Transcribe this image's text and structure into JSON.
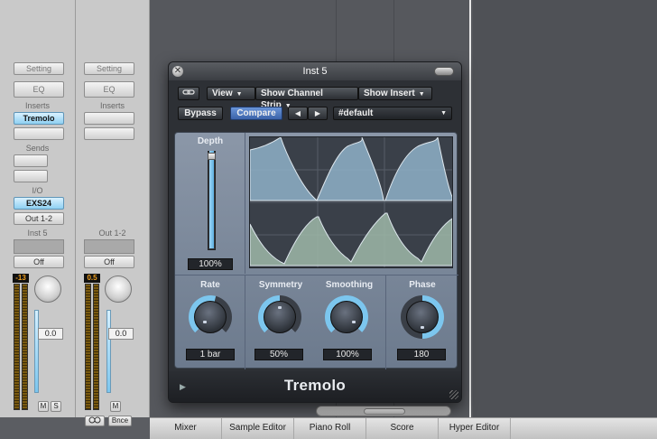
{
  "strips": [
    {
      "setting": "Setting",
      "eq": "EQ",
      "inserts_label": "Inserts",
      "insert1": "Tremolo",
      "sends_label": "Sends",
      "io_label": "I/O",
      "input": "EXS24",
      "output": "Out 1-2",
      "name": "Inst 5",
      "automation": "Off",
      "peak": "-13",
      "fader_value": "0.0",
      "mute": "M",
      "solo": "S"
    },
    {
      "setting": "Setting",
      "eq": "EQ",
      "inserts_label": "Inserts",
      "name": "Out 1-2",
      "automation": "Off",
      "peak": "0.5",
      "fader_value": "0.0",
      "mute": "M",
      "bounce": "Bnce"
    }
  ],
  "plugin": {
    "window_title": "Inst 5",
    "close_glyph": "✕",
    "toolbar": {
      "link_glyph": "🔗",
      "view": "View",
      "show_channel_strip": "Show Channel Strip",
      "show_insert": "Show Insert",
      "bypass": "Bypass",
      "compare": "Compare",
      "prev": "◀",
      "next": "▶",
      "preset": "#default",
      "dropdown_glyph": "▼"
    },
    "depth": {
      "label": "Depth",
      "value": "100%",
      "level": 1.0
    },
    "rate": {
      "label": "Rate",
      "value": "1 bar"
    },
    "symmetry": {
      "label": "Symmetry",
      "value": "50%"
    },
    "smoothing": {
      "label": "Smoothing",
      "value": "100%"
    },
    "phase": {
      "label": "Phase",
      "value": "180"
    },
    "name": "Tremolo",
    "disclosure_glyph": "▶",
    "colors": {
      "accent": "#7cc6ee",
      "wave_upper": "#8fb2c8",
      "wave_lower": "#9fb9a8"
    }
  },
  "tabs": [
    "Mixer",
    "Sample Editor",
    "Piano Roll",
    "Score",
    "Hyper Editor"
  ]
}
